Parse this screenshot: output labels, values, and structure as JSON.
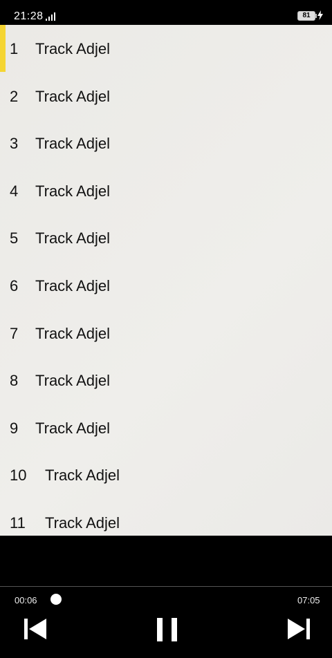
{
  "status": {
    "time": "21:28",
    "battery": "81"
  },
  "tracks": [
    {
      "num": "1",
      "title": "Track Adjel"
    },
    {
      "num": "2",
      "title": "Track Adjel"
    },
    {
      "num": "3",
      "title": "Track Adjel"
    },
    {
      "num": "4",
      "title": "Track Adjel"
    },
    {
      "num": "5",
      "title": "Track Adjel"
    },
    {
      "num": "6",
      "title": "Track Adjel"
    },
    {
      "num": "7",
      "title": "Track Adjel"
    },
    {
      "num": "8",
      "title": "Track Adjel"
    },
    {
      "num": "9",
      "title": "Track Adjel"
    },
    {
      "num": "10",
      "title": "Track Adjel"
    },
    {
      "num": "11",
      "title": "Track Adjel"
    }
  ],
  "player": {
    "current_time": "00:06",
    "total_time": "07:05",
    "progress_fraction": 0.014,
    "state": "playing"
  },
  "colors": {
    "active_accent": "#f5d532",
    "list_background": "#ecebe8",
    "player_background": "#000000"
  },
  "icons": [
    "signal-icon",
    "battery-icon",
    "charging-icon",
    "previous-icon",
    "pause-icon",
    "next-icon"
  ]
}
